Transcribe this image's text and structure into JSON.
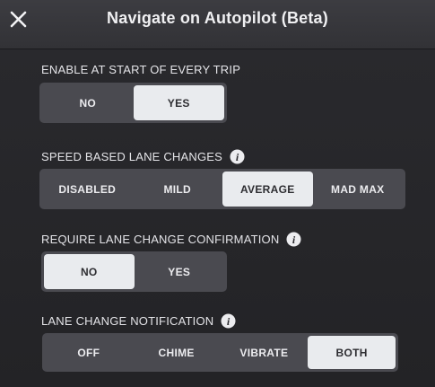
{
  "header": {
    "title": "Navigate on Autopilot (Beta)",
    "close_icon": "close-icon"
  },
  "sections": [
    {
      "label": "ENABLE AT START OF EVERY TRIP",
      "has_info": false,
      "options": [
        "NO",
        "YES"
      ],
      "selected": "YES"
    },
    {
      "label": "SPEED BASED LANE CHANGES",
      "has_info": true,
      "options": [
        "DISABLED",
        "MILD",
        "AVERAGE",
        "MAD MAX"
      ],
      "selected": "AVERAGE"
    },
    {
      "label": "REQUIRE LANE CHANGE CONFIRMATION",
      "has_info": true,
      "options": [
        "NO",
        "YES"
      ],
      "selected": "NO"
    },
    {
      "label": "LANE CHANGE NOTIFICATION",
      "has_info": true,
      "options": [
        "OFF",
        "CHIME",
        "VIBRATE",
        "BOTH"
      ],
      "selected": "BOTH"
    }
  ],
  "colors": {
    "background": "#262629",
    "header": "#36363a",
    "control_track": "#4a4a50",
    "selected_segment": "#e9ebee"
  }
}
